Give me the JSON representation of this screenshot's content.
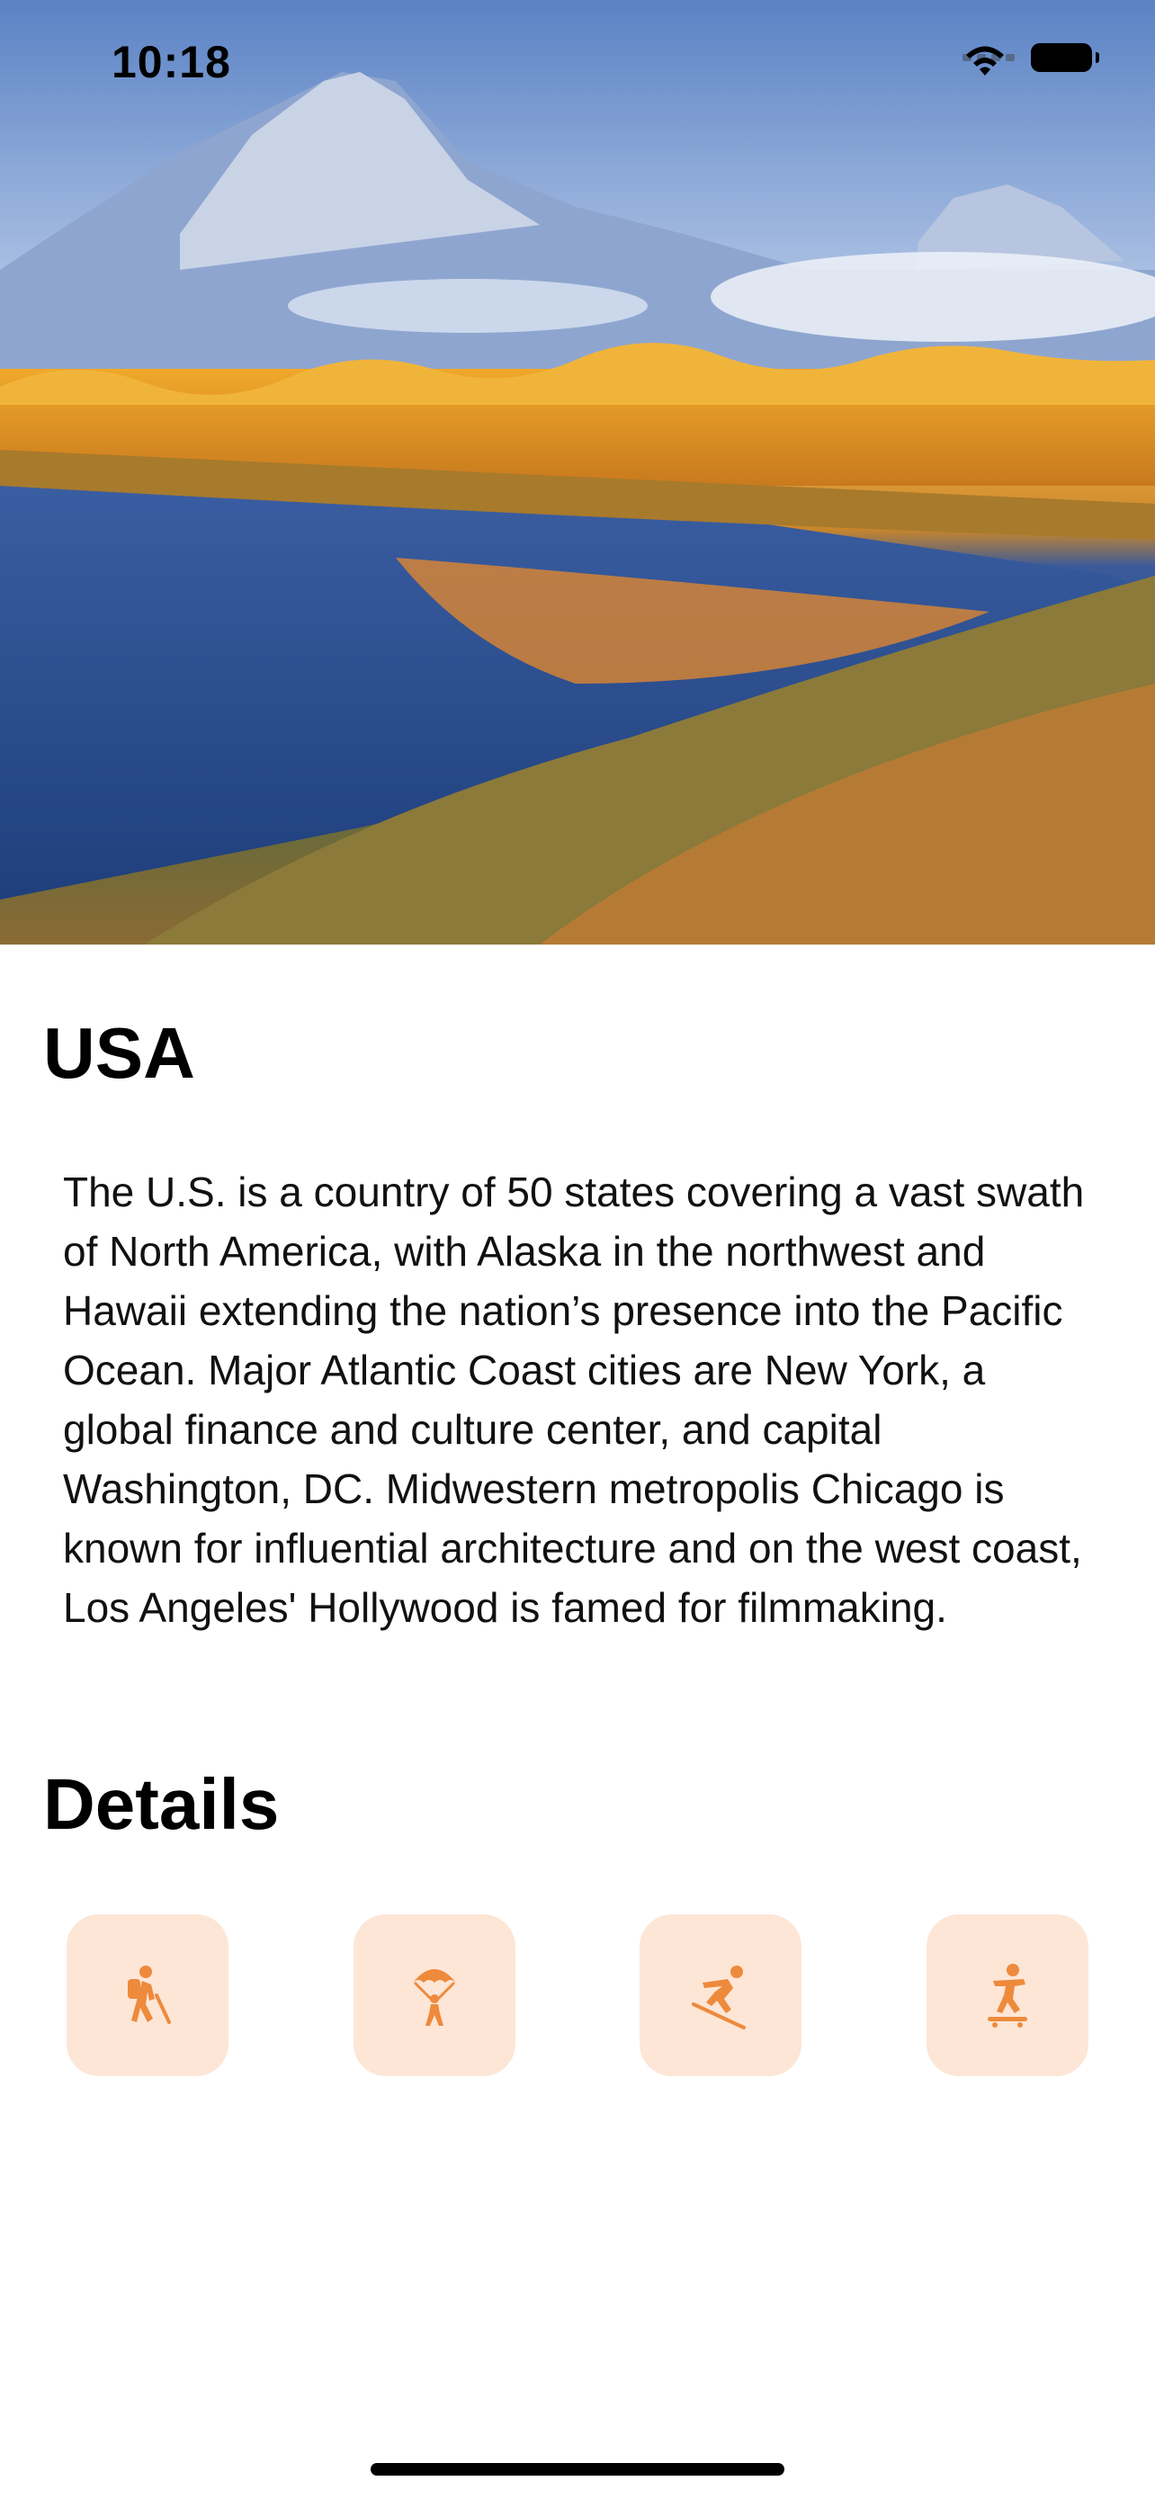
{
  "status_bar": {
    "time": "10:18",
    "icons": [
      "cellular-signal-icon",
      "wifi-icon",
      "battery-icon"
    ]
  },
  "hero": {
    "image_description_icon": "landscape-photo"
  },
  "country": {
    "name": "USA",
    "description": "The U.S. is a country of 50 states covering a vast swath of North America, with Alaska in the northwest and Hawaii extending the nation’s presence into the Pacific Ocean. Major Atlantic Coast cities are New York, a global finance and culture center, and capital Washington, DC. Midwestern metropolis Chicago is known for influential architecture and on the west coast, Los Angeles' Hollywood is famed for filmmaking."
  },
  "details": {
    "title": "Details",
    "activities": [
      {
        "icon": "hiking-icon"
      },
      {
        "icon": "parachuting-icon"
      },
      {
        "icon": "skiing-icon"
      },
      {
        "icon": "skateboarding-icon"
      }
    ]
  },
  "colors": {
    "accent": "#ee8a3c",
    "tile_background": "#fde6d6"
  }
}
